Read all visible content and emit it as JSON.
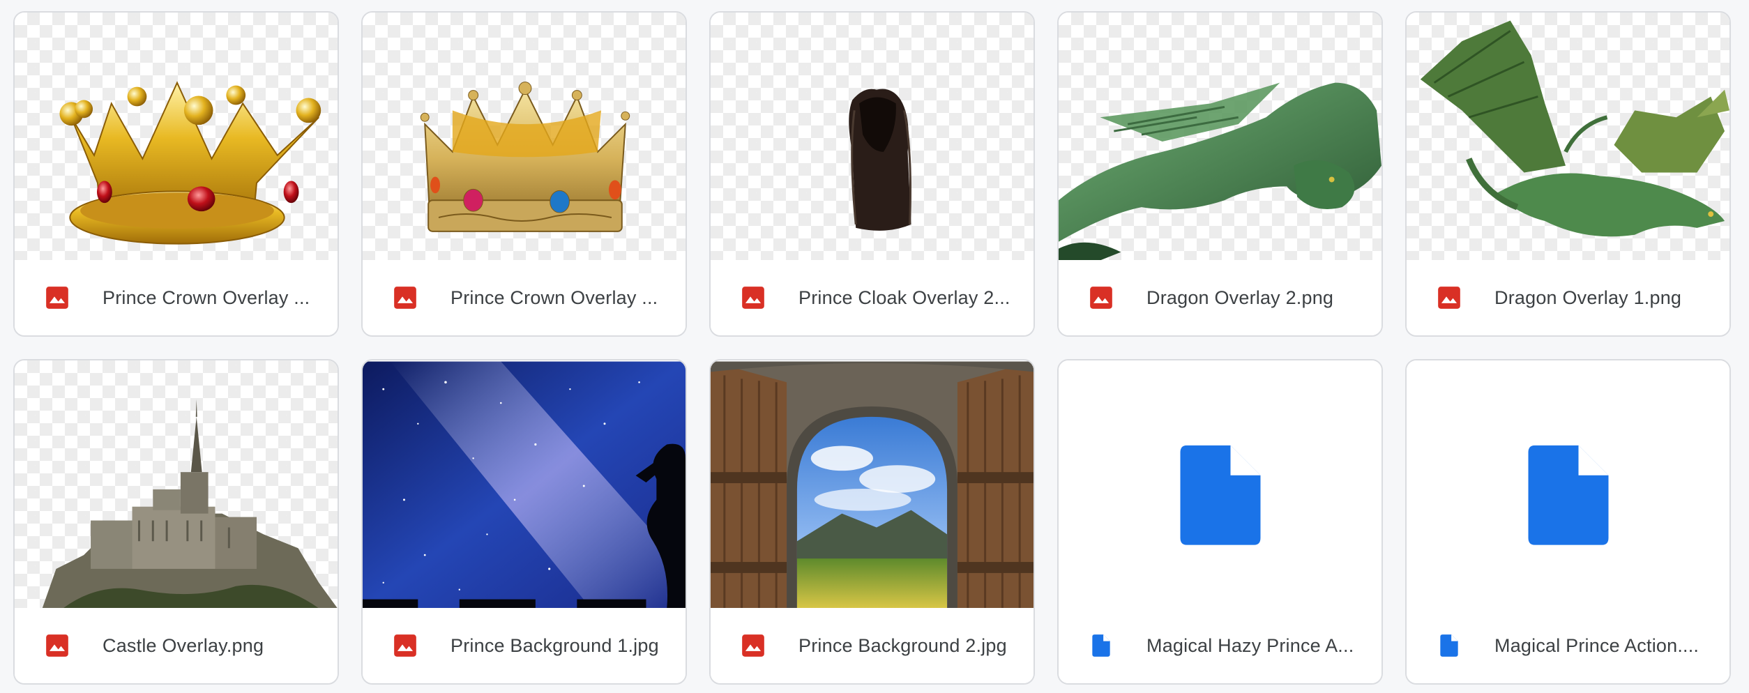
{
  "files": [
    {
      "name": "Prince Crown Overlay ...",
      "type": "image",
      "icon": "image-file-icon",
      "preview": "crown-gold"
    },
    {
      "name": "Prince Crown Overlay ...",
      "type": "image",
      "icon": "image-file-icon",
      "preview": "crown-jeweled"
    },
    {
      "name": "Prince Cloak Overlay 2...",
      "type": "image",
      "icon": "image-file-icon",
      "preview": "cloak"
    },
    {
      "name": "Dragon Overlay 2.png",
      "type": "image",
      "icon": "image-file-icon",
      "preview": "dragon-crouched"
    },
    {
      "name": "Dragon Overlay 1.png",
      "type": "image",
      "icon": "image-file-icon",
      "preview": "dragon-flying"
    },
    {
      "name": "Castle Overlay.png",
      "type": "image",
      "icon": "image-file-icon",
      "preview": "castle"
    },
    {
      "name": "Prince Background 1.jpg",
      "type": "image",
      "icon": "image-file-icon",
      "preview": "starry-sky"
    },
    {
      "name": "Prince Background 2.jpg",
      "type": "image",
      "icon": "image-file-icon",
      "preview": "doorway-landscape"
    },
    {
      "name": "Magical Hazy Prince A...",
      "type": "document",
      "icon": "document-file-icon",
      "preview": "document"
    },
    {
      "name": "Magical Prince Action....",
      "type": "document",
      "icon": "document-file-icon",
      "preview": "document"
    }
  ],
  "colors": {
    "image_icon": "#d93025",
    "doc_icon": "#1a73e8",
    "card_border": "#dadce0",
    "label_text": "#3c4043"
  }
}
